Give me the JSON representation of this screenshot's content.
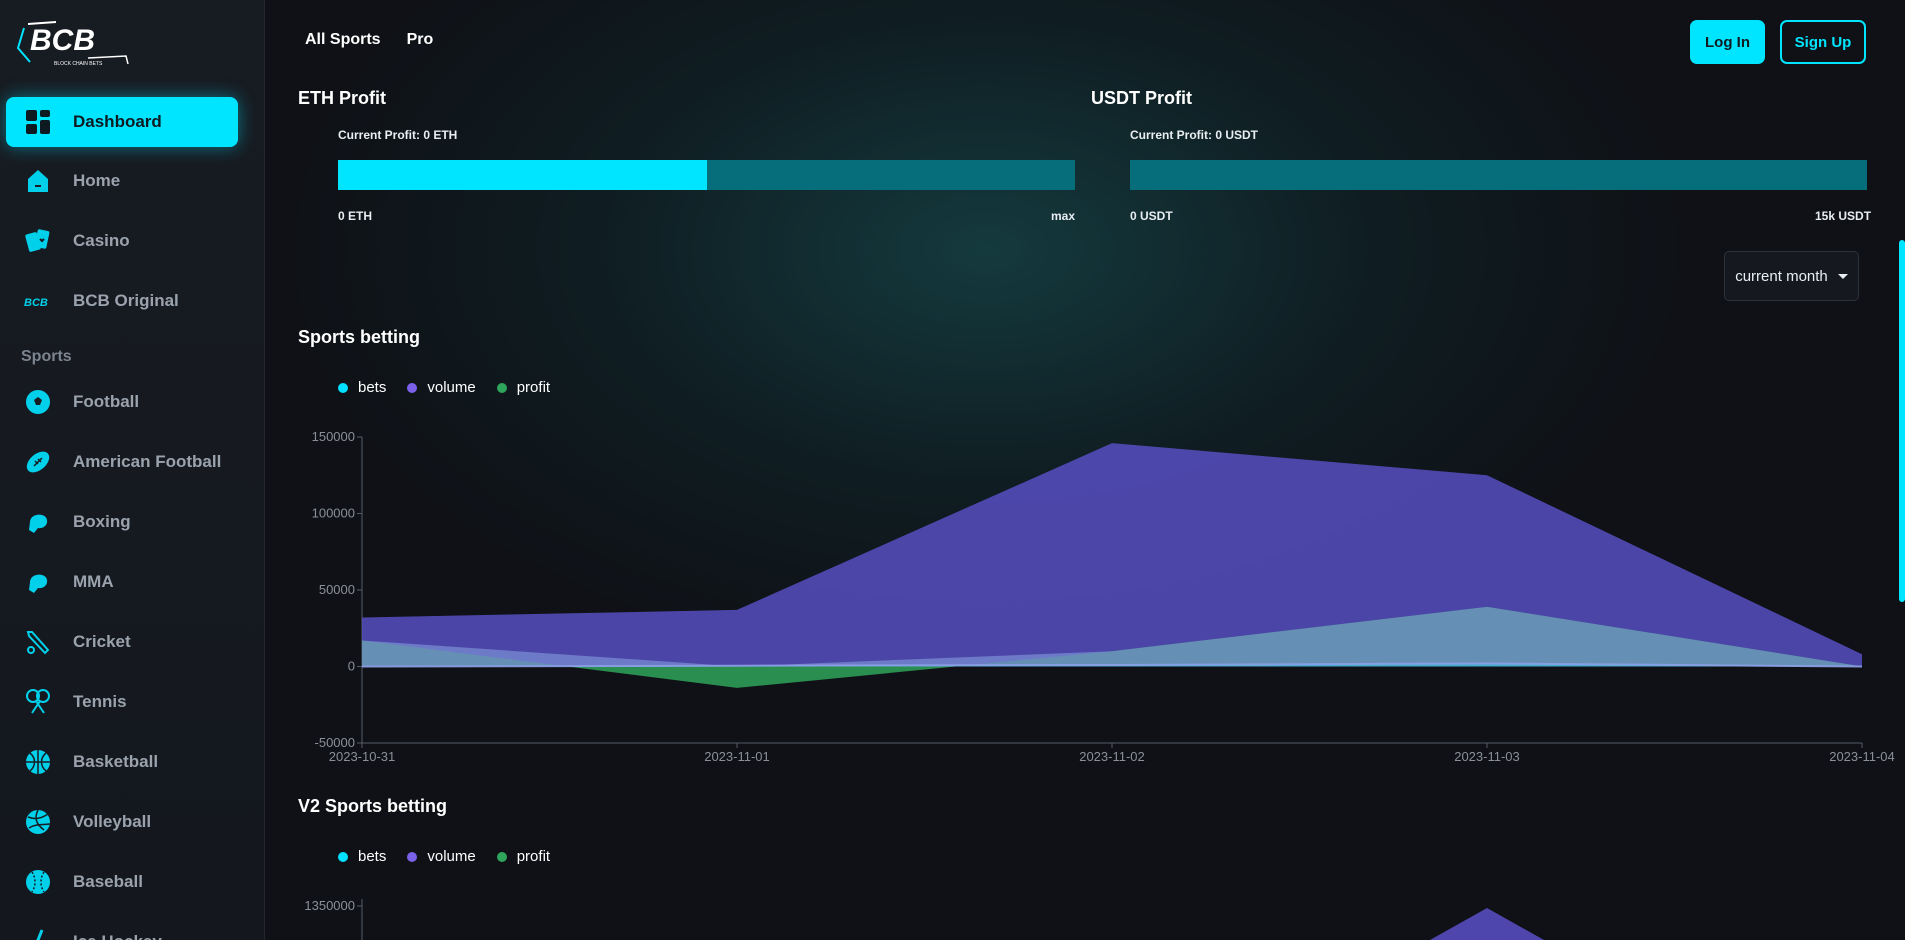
{
  "sidebar": {
    "logo_text": "BCB",
    "logo_subtext": "BLOCK CHAIN BETS",
    "items": [
      {
        "label": "Dashboard",
        "icon": "dashboard-icon"
      },
      {
        "label": "Home",
        "icon": "home-icon"
      },
      {
        "label": "Casino",
        "icon": "cards-icon"
      },
      {
        "label": "BCB Original",
        "icon": "bcb-icon"
      }
    ],
    "section": "Sports",
    "sports": [
      {
        "label": "Football",
        "icon": "soccer-ball-icon"
      },
      {
        "label": "American Football",
        "icon": "american-football-icon"
      },
      {
        "label": "Boxing",
        "icon": "boxing-glove-icon"
      },
      {
        "label": "MMA",
        "icon": "mma-glove-icon"
      },
      {
        "label": "Cricket",
        "icon": "cricket-bat-icon"
      },
      {
        "label": "Tennis",
        "icon": "tennis-racket-icon"
      },
      {
        "label": "Basketball",
        "icon": "basketball-icon"
      },
      {
        "label": "Volleyball",
        "icon": "volleyball-icon"
      },
      {
        "label": "Baseball",
        "icon": "baseball-icon"
      },
      {
        "label": "Ice Hockey",
        "icon": "hockey-stick-icon"
      }
    ]
  },
  "header": {
    "nav": [
      "All Sports",
      "Pro"
    ],
    "login": "Log In",
    "signup": "Sign Up"
  },
  "eth": {
    "title": "ETH Profit",
    "current": "Current Profit: 0 ETH",
    "min": "0 ETH",
    "max": "max",
    "fill_fraction": 0.5
  },
  "usdt": {
    "title": "USDT Profit",
    "current": "Current Profit: 0 USDT",
    "min": "0 USDT",
    "max": "15k USDT",
    "fill_fraction": 0
  },
  "period": "current month",
  "colors": {
    "accent": "#00e5ff",
    "bets": "#00e0ff",
    "volume": "#7b61e8",
    "profit": "#2ea55a"
  },
  "chart_data": [
    {
      "type": "area",
      "title": "Sports betting",
      "x": [
        "2023-10-31",
        "2023-11-01",
        "2023-11-02",
        "2023-11-03",
        "2023-11-04"
      ],
      "ylim": [
        -50000,
        150000
      ],
      "yticks": [
        "150000",
        "100000",
        "50000",
        "0",
        "-50000"
      ],
      "series": [
        {
          "name": "bets",
          "values": [
            0,
            500,
            1000,
            2000,
            0
          ]
        },
        {
          "name": "volume",
          "values": [
            32000,
            37000,
            146000,
            125000,
            8000
          ]
        },
        {
          "name": "profit",
          "values": [
            17000,
            -14000,
            10000,
            39000,
            0
          ]
        }
      ],
      "legend": "top-left"
    },
    {
      "type": "area",
      "title": "V2 Sports betting",
      "yticks": [
        "1350000"
      ],
      "series": [
        {
          "name": "bets"
        },
        {
          "name": "volume"
        },
        {
          "name": "profit"
        }
      ],
      "legend": "top-left"
    }
  ]
}
